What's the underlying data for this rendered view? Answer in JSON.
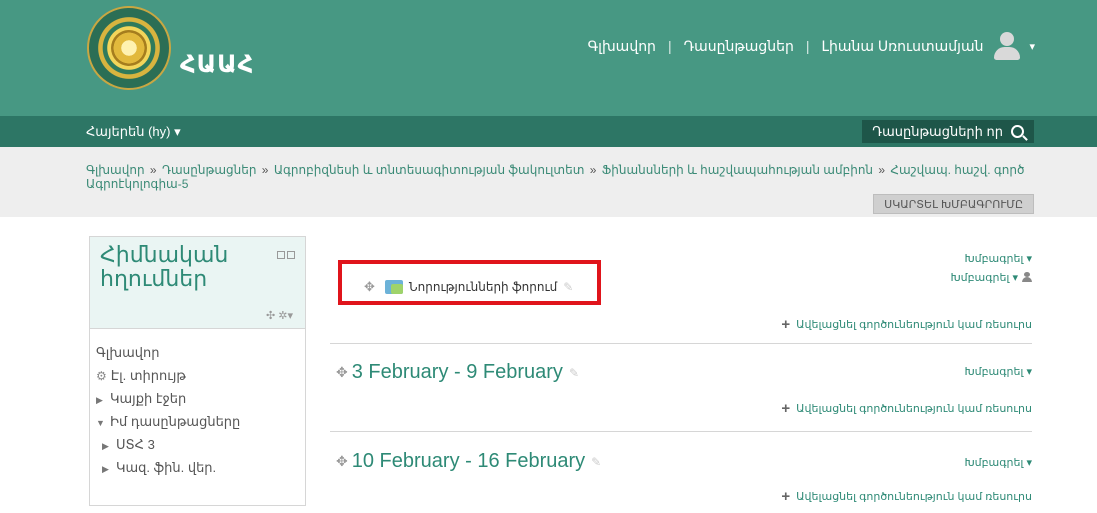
{
  "header": {
    "brand": "ՀԱԱՀ",
    "nav": [
      "Գլխավոր",
      "Դասընթացներ",
      "Լիանա Սռուստամյան"
    ]
  },
  "langbar": {
    "language": "Հայերեն (hy) ▾",
    "courses_label": "Դասընթացների որ"
  },
  "breadcrumb": {
    "items": [
      "Գլխավոր",
      "Դասընթացներ",
      "Ագրոբիզնեսի և տնտեսագիտության ֆակուլտետ",
      "Ֆինանսների և հաշվապահության ամբիոն",
      "Հաշվապ. հաշվ. գործ Ագրոէկոլոգիա-5"
    ],
    "edit_button": "ՍԿԱՐՏԵԼ ԽՄԲԱԳՐՈՒՄԸ"
  },
  "sidebar": {
    "title": "Հիմնական հղումներ",
    "items": [
      "Գլխավոր",
      "Էլ. տիրույթ",
      "Կայքի էջեր",
      "Իմ դասընթացները",
      "ՍՏՀ 3",
      "Կազ. ֆին. վեր."
    ]
  },
  "main": {
    "edit_label": "Խմբագրել ▾",
    "add_activity": "Ավելացնել գործունեություն կամ ռեսուրս",
    "forum_activity": "Նորությունների ֆորում",
    "weeks": [
      "3 February - 9 February",
      "10 February - 16 February"
    ]
  }
}
